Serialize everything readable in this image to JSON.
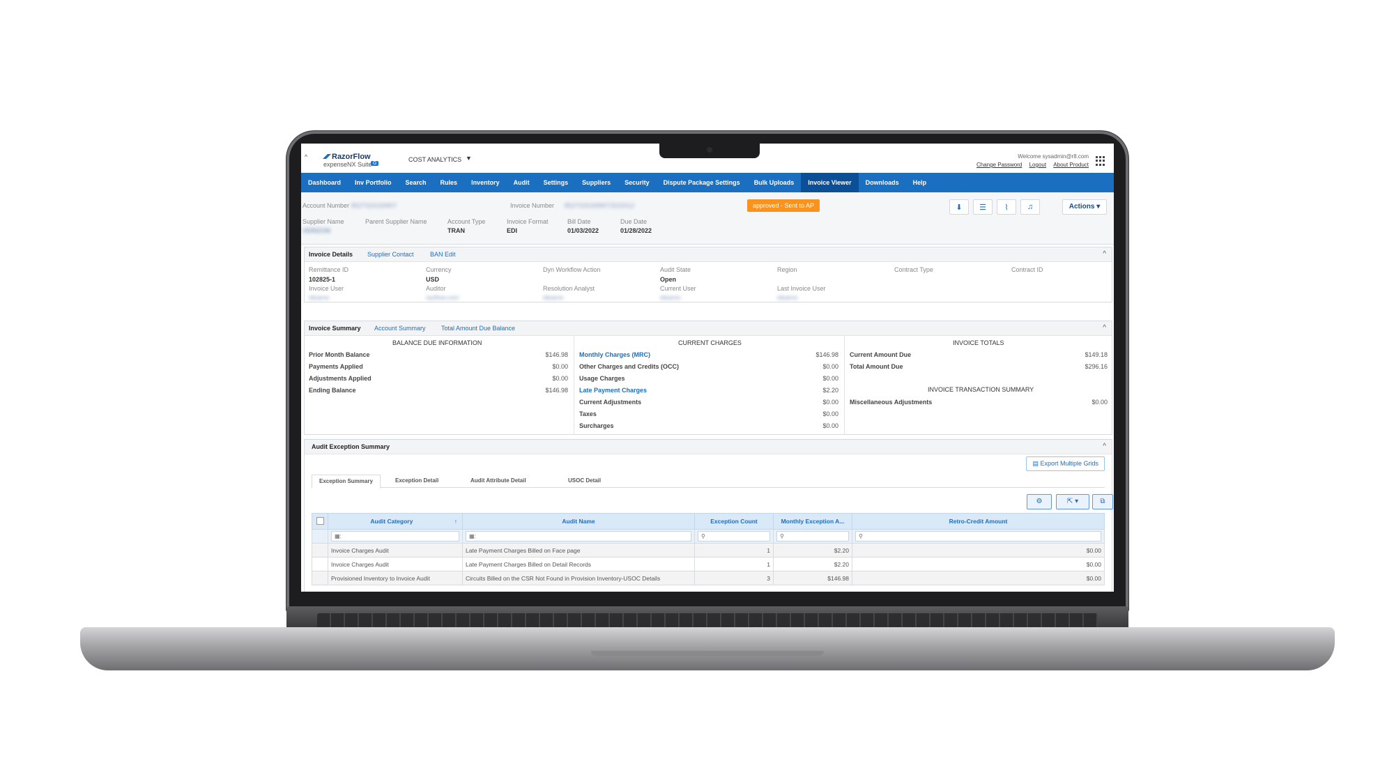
{
  "header": {
    "logo_title": "RazorFlow",
    "logo_sub": "expenseNX Suite",
    "logo_badge": "G",
    "module": "COST ANALYTICS",
    "welcome": "Welcome sysadmin@r8.com",
    "links": [
      "Change Password",
      "Logout",
      "About Product"
    ]
  },
  "nav": [
    "Dashboard",
    "Inv Portfolio",
    "Search",
    "Rules",
    "Inventory",
    "Audit",
    "Settings",
    "Suppliers",
    "Security",
    "Dispute Package Settings",
    "Bulk Uploads",
    "Invoice Viewer",
    "Downloads",
    "Help"
  ],
  "nav_active": "Invoice Viewer",
  "account": {
    "account_number_label": "Account Number",
    "account_number": "8527315169907",
    "invoice_number_label": "Invoice Number",
    "invoice_number": "85273151699072022012",
    "supplier_name_label": "Supplier Name",
    "supplier_name": "VERIZON",
    "parent_supplier_label": "Parent Supplier Name",
    "account_type_label": "Account Type",
    "account_type": "TRAN",
    "invoice_format_label": "Invoice Format",
    "invoice_format": "EDI",
    "bill_date_label": "Bill Date",
    "bill_date": "01/03/2022",
    "due_date_label": "Due Date",
    "due_date": "01/28/2022",
    "status": "approved - Sent to AP",
    "actions": "Actions"
  },
  "invoice_details": {
    "tabs": [
      "Invoice Details",
      "Supplier Contact",
      "BAN Edit"
    ],
    "fields": {
      "remittance_id_label": "Remittance ID",
      "remittance_id": "102825-1",
      "currency_label": "Currency",
      "currency": "USD",
      "dyn_workflow_label": "Dyn Workflow Action",
      "audit_state_label": "Audit State",
      "audit_state": "Open",
      "region_label": "Region",
      "contract_type_label": "Contract Type",
      "contract_id_label": "Contract ID",
      "invoice_user_label": "Invoice User",
      "invoice_user": "ideamo",
      "auditor_label": "Auditor",
      "auditor": "razflow.com",
      "resolution_analyst_label": "Resolution Analyst",
      "resolution_analyst": "ideamo",
      "current_user_label": "Current User",
      "current_user": "ideamo",
      "last_invoice_user_label": "Last Invoice User",
      "last_invoice_user": "ideamo"
    }
  },
  "invoice_summary": {
    "tabs": [
      "Invoice Summary",
      "Account Summary",
      "Total Amount Due Balance"
    ],
    "balance_title": "BALANCE DUE INFORMATION",
    "balance": [
      {
        "label": "Prior Month Balance",
        "value": "$146.98"
      },
      {
        "label": "Payments Applied",
        "value": "$0.00"
      },
      {
        "label": "Adjustments Applied",
        "value": "$0.00"
      },
      {
        "label": "Ending Balance",
        "value": "$146.98"
      }
    ],
    "charges_title": "CURRENT CHARGES",
    "charges": [
      {
        "label": "Monthly Charges (MRC)",
        "value": "$146.98"
      },
      {
        "label": "Other Charges and Credits (OCC)",
        "value": "$0.00"
      },
      {
        "label": "Usage Charges",
        "value": "$0.00"
      },
      {
        "label": "Late Payment Charges",
        "value": "$2.20"
      },
      {
        "label": "Current Adjustments",
        "value": "$0.00"
      },
      {
        "label": "Taxes",
        "value": "$0.00"
      },
      {
        "label": "Surcharges",
        "value": "$0.00"
      }
    ],
    "totals_title": "INVOICE TOTALS",
    "totals": [
      {
        "label": "Current Amount Due",
        "value": "$149.18"
      },
      {
        "label": "Total Amount Due",
        "value": "$296.16"
      }
    ],
    "transaction_title": "INVOICE TRANSACTION SUMMARY",
    "transactions": [
      {
        "label": "Miscellaneous Adjustments",
        "value": "$0.00"
      }
    ]
  },
  "audit": {
    "title": "Audit Exception Summary",
    "export": "Export Multiple Grids",
    "subtabs": [
      "Exception Summary",
      "Exception Detail",
      "Audit Attribute Detail",
      "USOC Detail"
    ],
    "columns": [
      "Audit Category",
      "Audit Name",
      "Exception Count",
      "Monthly Exception A...",
      "Retro-Credit Amount"
    ],
    "rows": [
      {
        "category": "Invoice Charges Audit",
        "name": "Late Payment Charges Billed on Face page",
        "count": "1",
        "monthly": "$2.20",
        "retro": "$0.00"
      },
      {
        "category": "Invoice Charges Audit",
        "name": "Late Payment Charges Billed on Detail Records",
        "count": "1",
        "monthly": "$2.20",
        "retro": "$0.00"
      },
      {
        "category": "Provisioned Inventory to Invoice Audit",
        "name": "Circuits Billed on the CSR Not Found in Provision Inventory-USOC Details",
        "count": "3",
        "monthly": "$146.98",
        "retro": "$0.00"
      }
    ]
  }
}
